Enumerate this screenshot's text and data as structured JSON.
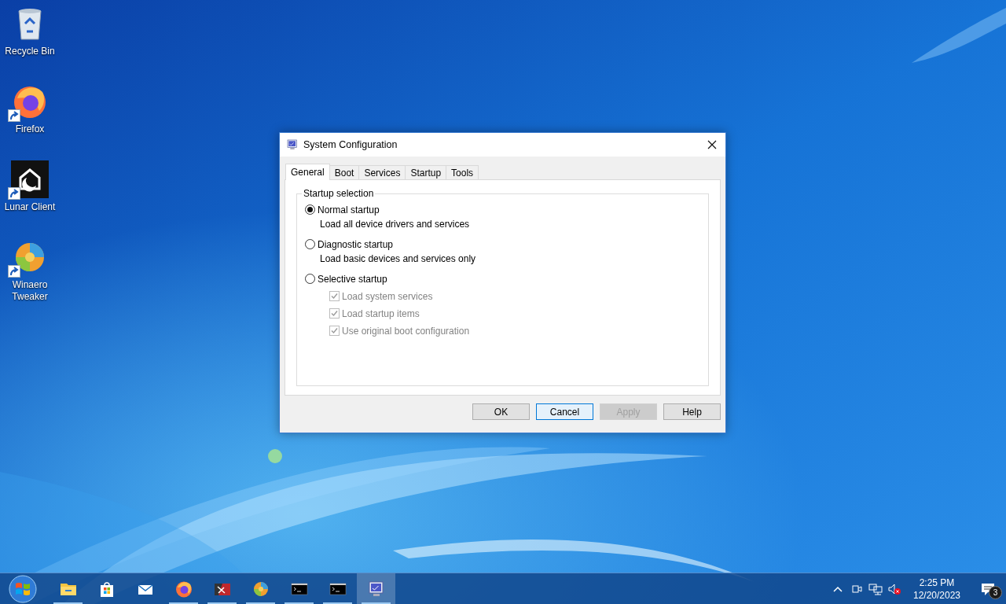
{
  "desktop_icons": [
    {
      "kind": "recycle",
      "label": "Recycle Bin",
      "shortcut": false
    },
    {
      "kind": "firefox",
      "label": "Firefox",
      "shortcut": true
    },
    {
      "kind": "lunar",
      "label": "Lunar Client",
      "shortcut": true
    },
    {
      "kind": "winaero",
      "label": "Winaero Tweaker",
      "shortcut": true
    }
  ],
  "dialog": {
    "title": "System Configuration",
    "tabs": [
      {
        "label": "General",
        "selected": true
      },
      {
        "label": "Boot",
        "selected": false
      },
      {
        "label": "Services",
        "selected": false
      },
      {
        "label": "Startup",
        "selected": false
      },
      {
        "label": "Tools",
        "selected": false
      }
    ],
    "group_title": "Startup selection",
    "options": [
      {
        "label": "Normal startup",
        "selected": true,
        "description": "Load all device drivers and services"
      },
      {
        "label": "Diagnostic startup",
        "selected": false,
        "description": "Load basic devices and services only"
      },
      {
        "label": "Selective startup",
        "selected": false,
        "checkboxes": [
          {
            "label": "Load system services",
            "checked": true,
            "disabled": true
          },
          {
            "label": "Load startup items",
            "checked": true,
            "disabled": true
          },
          {
            "label": "Use original boot configuration",
            "checked": true,
            "disabled": true
          }
        ]
      }
    ],
    "buttons": [
      {
        "label": "OK",
        "focused": false,
        "disabled": false
      },
      {
        "label": "Cancel",
        "focused": true,
        "disabled": false
      },
      {
        "label": "Apply",
        "focused": false,
        "disabled": true
      },
      {
        "label": "Help",
        "focused": false,
        "disabled": false
      }
    ]
  },
  "taskbar": {
    "apps": [
      {
        "kind": "explorer",
        "running": true,
        "active": false
      },
      {
        "kind": "store",
        "running": false,
        "active": false
      },
      {
        "kind": "mail",
        "running": false,
        "active": false
      },
      {
        "kind": "firefox",
        "running": true,
        "active": false
      },
      {
        "kind": "redtool",
        "running": true,
        "active": false
      },
      {
        "kind": "winaero",
        "running": true,
        "active": false
      },
      {
        "kind": "console",
        "running": true,
        "active": false
      },
      {
        "kind": "console",
        "running": true,
        "active": false
      },
      {
        "kind": "msconfig",
        "running": true,
        "active": true
      }
    ],
    "time": "2:25 PM",
    "date": "12/20/2023",
    "notification_count": "3"
  }
}
